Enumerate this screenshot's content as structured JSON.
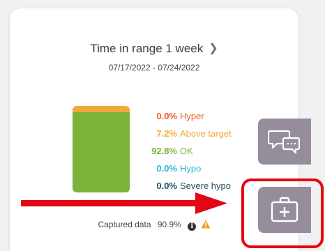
{
  "card": {
    "title": "Time in range 1 week",
    "date_range": "07/17/2022 - 07/24/2022",
    "chevron_icon": "chevron-right-icon"
  },
  "time_in_range": [
    {
      "pct": "0.0%",
      "label": "Hyper",
      "value": 0.0,
      "color": "#f05a28"
    },
    {
      "pct": "7.2%",
      "label": "Above target",
      "value": 7.2,
      "color": "#f2a93b"
    },
    {
      "pct": "92.8%",
      "label": "OK",
      "value": 92.8,
      "color": "#7cb33b"
    },
    {
      "pct": "0.0%",
      "label": "Hypo",
      "value": 0.0,
      "color": "#2bb8d6"
    },
    {
      "pct": "0.0%",
      "label": "Severe hypo",
      "value": 0.0,
      "color": "#1f4e5f"
    }
  ],
  "footer": {
    "captured_label": "Captured data",
    "captured_value": "90.9%",
    "info_icon": "info-icon",
    "warning_icon": "warning-icon"
  },
  "side_buttons": {
    "chat_icon": "chat-bubbles-icon",
    "kit_icon": "medical-kit-icon"
  },
  "colors": {
    "side_button": "#958c9c",
    "highlight": "#e30613"
  }
}
